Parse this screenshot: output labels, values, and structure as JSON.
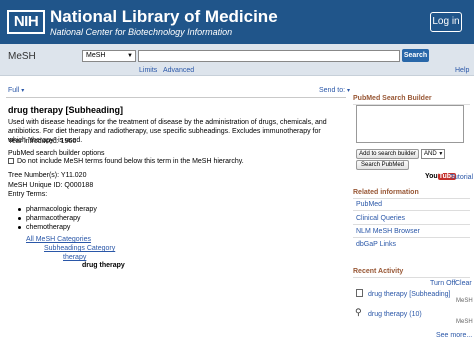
{
  "header": {
    "logo_text": "NIH",
    "title": "National Library of Medicine",
    "subtitle": "National Center for Biotechnology Information",
    "login_label": "Log in"
  },
  "search": {
    "db_label": "MeSH",
    "db_select_value": "MeSH",
    "query_value": "",
    "search_button": "Search",
    "limits_link": "Limits",
    "advanced_link": "Advanced",
    "help_link": "Help"
  },
  "toolbar": {
    "full_label": "Full",
    "send_to_label": "Send to:"
  },
  "record": {
    "title": "drug therapy [Subheading]",
    "description": "Used with disease headings for the treatment of disease by the administration of drugs, chemicals, and antibiotics. For diet therapy and radiotherapy, use specific subheadings. Excludes immunotherapy for which \"therapy\" is used.",
    "year_introduced": "Year introduced: 1966",
    "builder_options": "PubMed search builder options",
    "checkbox_label": "Do not include MeSH terms found below this term in the MeSH hierarchy.",
    "tree_number": "Tree Number(s): Y11.020",
    "unique_id": "MeSH Unique ID: Q000188",
    "entry_terms_label": "Entry Terms:",
    "entry_terms": [
      "pharmacologic therapy",
      "pharmacotherapy",
      "chemotherapy"
    ],
    "hierarchy": {
      "level1": "All MeSH Categories",
      "level2": "Subheadings Category",
      "level3": "therapy",
      "current": "drug therapy"
    }
  },
  "sidebar": {
    "builder_title": "PubMed Search Builder",
    "add_button": "Add to search builder",
    "operator_value": "AND",
    "search_pubmed_button": "Search PubMed",
    "youtube_you": "You",
    "youtube_tube": "Tube",
    "tutorial_link": "Tutorial",
    "related_title": "Related information",
    "related_links": [
      "PubMed",
      "Clinical Queries",
      "NLM MeSH Browser",
      "dbGaP Links"
    ],
    "recent_title": "Recent Activity",
    "turn_off": "Turn Off",
    "clear": "Clear",
    "recent_items": [
      {
        "label": "drug therapy [Subheading]",
        "db": "MeSH"
      },
      {
        "label": "drug therapy (10)",
        "db": "MeSH"
      }
    ],
    "see_more": "See more..."
  },
  "colors": {
    "header_bg": "#20558a",
    "link": "#2a57a8",
    "section_title": "#985735"
  }
}
